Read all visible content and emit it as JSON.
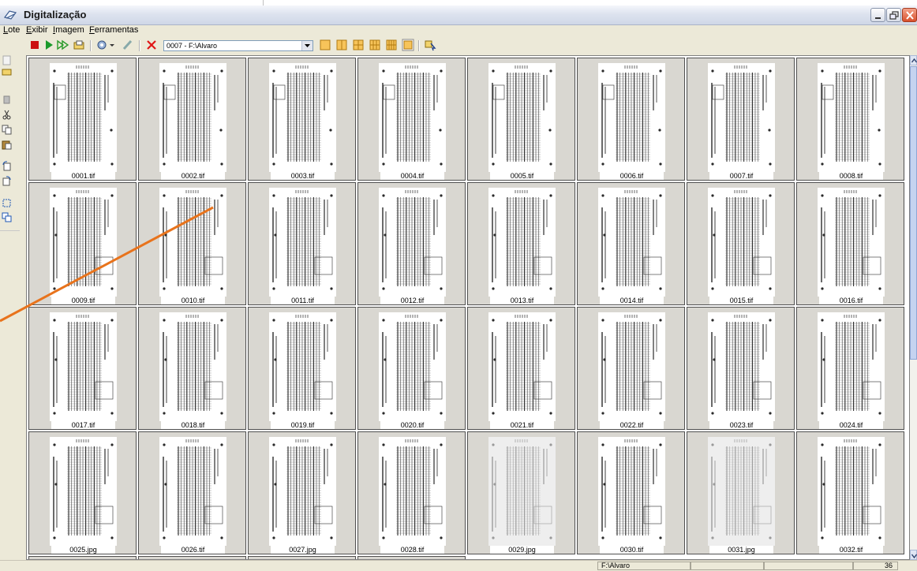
{
  "window": {
    "title": "Digitalização"
  },
  "menu": [
    "Lote",
    "Exibir",
    "Imagem",
    "Ferramentas"
  ],
  "toolbar": {
    "batch_combo": "0007 - F:\\Alvaro"
  },
  "thumbnails": [
    {
      "file": "0001.tif"
    },
    {
      "file": "0002.tif"
    },
    {
      "file": "0003.tif"
    },
    {
      "file": "0004.tif"
    },
    {
      "file": "0005.tif"
    },
    {
      "file": "0006.tif"
    },
    {
      "file": "0007.tif"
    },
    {
      "file": "0008.tif"
    },
    {
      "file": "0009.tif"
    },
    {
      "file": "0010.tif"
    },
    {
      "file": "0011.tif"
    },
    {
      "file": "0012.tif"
    },
    {
      "file": "0013.tif"
    },
    {
      "file": "0014.tif"
    },
    {
      "file": "0015.tif"
    },
    {
      "file": "0016.tif"
    },
    {
      "file": "0017.tif"
    },
    {
      "file": "0018.tif"
    },
    {
      "file": "0019.tif"
    },
    {
      "file": "0020.tif"
    },
    {
      "file": "0021.tif"
    },
    {
      "file": "0022.tif"
    },
    {
      "file": "0023.tif"
    },
    {
      "file": "0024.tif"
    },
    {
      "file": "0025.jpg"
    },
    {
      "file": "0026.tif"
    },
    {
      "file": "0027.jpg"
    },
    {
      "file": "0028.tif"
    },
    {
      "file": "0029.jpg",
      "faded": true
    },
    {
      "file": "0030.tif"
    },
    {
      "file": "0031.jpg",
      "faded": true
    },
    {
      "file": "0032.tif"
    }
  ],
  "statusbar": {
    "path": "F:\\Alvaro",
    "count": "36"
  },
  "colors": {
    "accent_arrow": "#e8731c",
    "close_button": "#d9502c"
  }
}
